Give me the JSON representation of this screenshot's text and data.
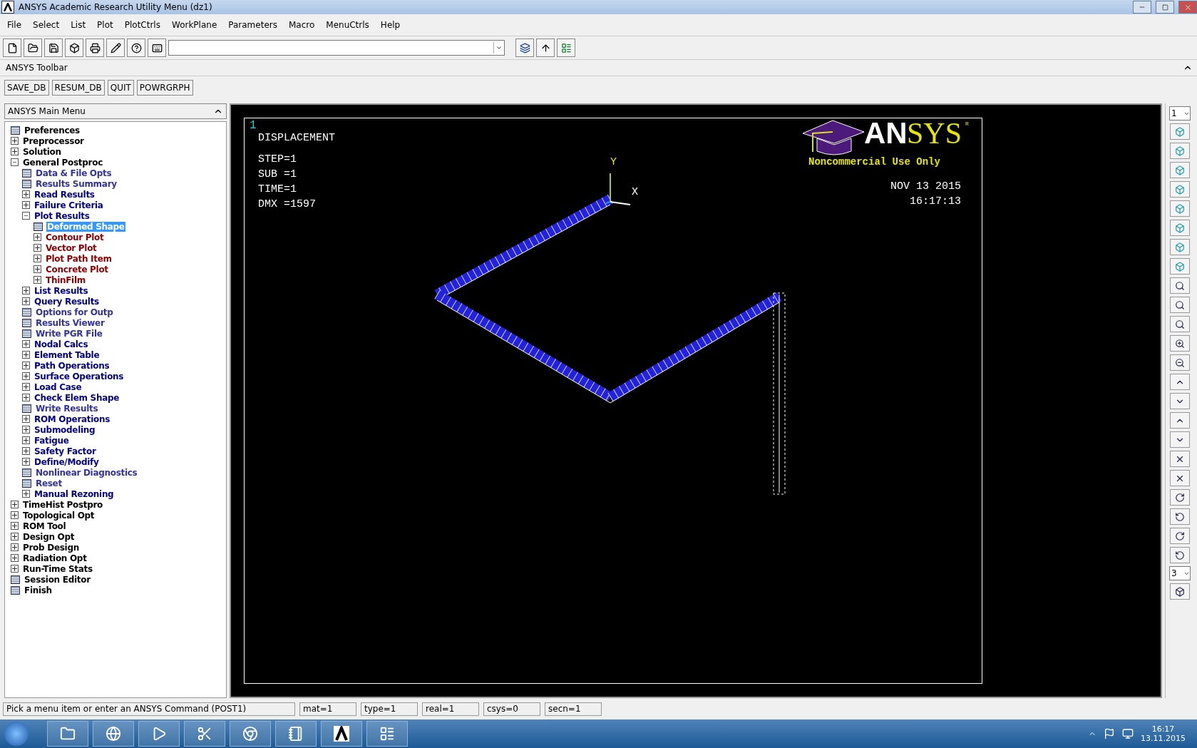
{
  "window": {
    "title": "ANSYS Academic Research Utility Menu (dz1)"
  },
  "menu_bar": [
    "File",
    "Select",
    "List",
    "Plot",
    "PlotCtrls",
    "WorkPlane",
    "Parameters",
    "Macro",
    "MenuCtrls",
    "Help"
  ],
  "ansys_toolbar": {
    "title": "ANSYS Toolbar",
    "buttons": [
      "SAVE_DB",
      "RESUM_DB",
      "QUIT",
      "POWRGRPH"
    ]
  },
  "main_menu": {
    "title": "ANSYS Main Menu",
    "items": [
      {
        "label": "Preferences",
        "kind": "action",
        "selected": false
      },
      {
        "label": "Preprocessor",
        "kind": "folder",
        "expanded": false,
        "selected": false
      },
      {
        "label": "Solution",
        "kind": "folder",
        "expanded": false,
        "selected": false
      },
      {
        "label": "General Postproc",
        "kind": "folder",
        "expanded": true,
        "selected": false,
        "children": [
          {
            "label": "Data & File Opts",
            "kind": "action",
            "selected": false
          },
          {
            "label": "Results Summary",
            "kind": "action",
            "selected": false
          },
          {
            "label": "Read Results",
            "kind": "folder",
            "expanded": false,
            "selected": false
          },
          {
            "label": "Failure Criteria",
            "kind": "folder",
            "expanded": false,
            "selected": false
          },
          {
            "label": "Plot Results",
            "kind": "folder",
            "expanded": true,
            "selected": false,
            "children": [
              {
                "label": "Deformed Shape",
                "kind": "action",
                "selected": true
              },
              {
                "label": "Contour Plot",
                "kind": "folder",
                "expanded": false,
                "selected": false
              },
              {
                "label": "Vector Plot",
                "kind": "folder",
                "expanded": false,
                "selected": false
              },
              {
                "label": "Plot Path Item",
                "kind": "folder",
                "expanded": false,
                "selected": false
              },
              {
                "label": "Concrete Plot",
                "kind": "folder",
                "expanded": false,
                "selected": false
              },
              {
                "label": "ThinFilm",
                "kind": "folder",
                "expanded": false,
                "selected": false
              }
            ]
          },
          {
            "label": "List Results",
            "kind": "folder",
            "expanded": false,
            "selected": false
          },
          {
            "label": "Query Results",
            "kind": "folder",
            "expanded": false,
            "selected": false
          },
          {
            "label": "Options for Outp",
            "kind": "action",
            "selected": false
          },
          {
            "label": "Results Viewer",
            "kind": "action",
            "selected": false
          },
          {
            "label": "Write PGR File",
            "kind": "action",
            "selected": false
          },
          {
            "label": "Nodal Calcs",
            "kind": "folder",
            "expanded": false,
            "selected": false
          },
          {
            "label": "Element Table",
            "kind": "folder",
            "expanded": false,
            "selected": false
          },
          {
            "label": "Path Operations",
            "kind": "folder",
            "expanded": false,
            "selected": false
          },
          {
            "label": "Surface Operations",
            "kind": "folder",
            "expanded": false,
            "selected": false
          },
          {
            "label": "Load Case",
            "kind": "folder",
            "expanded": false,
            "selected": false
          },
          {
            "label": "Check Elem Shape",
            "kind": "folder",
            "expanded": false,
            "selected": false
          },
          {
            "label": "Write Results",
            "kind": "action",
            "selected": false
          },
          {
            "label": "ROM Operations",
            "kind": "folder",
            "expanded": false,
            "selected": false
          },
          {
            "label": "Submodeling",
            "kind": "folder",
            "expanded": false,
            "selected": false
          },
          {
            "label": "Fatigue",
            "kind": "folder",
            "expanded": false,
            "selected": false
          },
          {
            "label": "Safety Factor",
            "kind": "folder",
            "expanded": false,
            "selected": false
          },
          {
            "label": "Define/Modify",
            "kind": "folder",
            "expanded": false,
            "selected": false
          },
          {
            "label": "Nonlinear Diagnostics",
            "kind": "action",
            "selected": false
          },
          {
            "label": "Reset",
            "kind": "action",
            "selected": false
          },
          {
            "label": "Manual Rezoning",
            "kind": "folder",
            "expanded": false,
            "selected": false
          }
        ]
      },
      {
        "label": "TimeHist Postpro",
        "kind": "folder",
        "expanded": false,
        "selected": false
      },
      {
        "label": "Topological Opt",
        "kind": "folder",
        "expanded": false,
        "selected": false
      },
      {
        "label": "ROM Tool",
        "kind": "folder",
        "expanded": false,
        "selected": false
      },
      {
        "label": "Design Opt",
        "kind": "folder",
        "expanded": false,
        "selected": false
      },
      {
        "label": "Prob Design",
        "kind": "folder",
        "expanded": false,
        "selected": false
      },
      {
        "label": "Radiation Opt",
        "kind": "folder",
        "expanded": false,
        "selected": false
      },
      {
        "label": "Run-Time Stats",
        "kind": "folder",
        "expanded": false,
        "selected": false
      },
      {
        "label": "Session Editor",
        "kind": "action",
        "selected": false
      },
      {
        "label": "Finish",
        "kind": "action",
        "selected": false
      }
    ]
  },
  "graphics": {
    "window_number": "1",
    "title": "DISPLACEMENT",
    "info": [
      "STEP=1",
      "SUB =1",
      "TIME=1",
      "DMX =1597"
    ],
    "logo": {
      "left": "AN",
      "right": "SYS",
      "mark": "R",
      "note": "Noncommercial Use Only"
    },
    "date": "NOV 13 2015",
    "time": "16:17:13",
    "axis_x": "X",
    "axis_y": "Y"
  },
  "right_toolbar": {
    "window_select": "1",
    "view_select": "3"
  },
  "status_bar": [
    "Pick a menu item or enter an ANSYS Command (POST1)",
    "mat=1",
    "type=1",
    "real=1",
    "csys=0",
    "secn=1"
  ],
  "taskbar": {
    "time": "16:17",
    "date": "13.11.2015"
  }
}
